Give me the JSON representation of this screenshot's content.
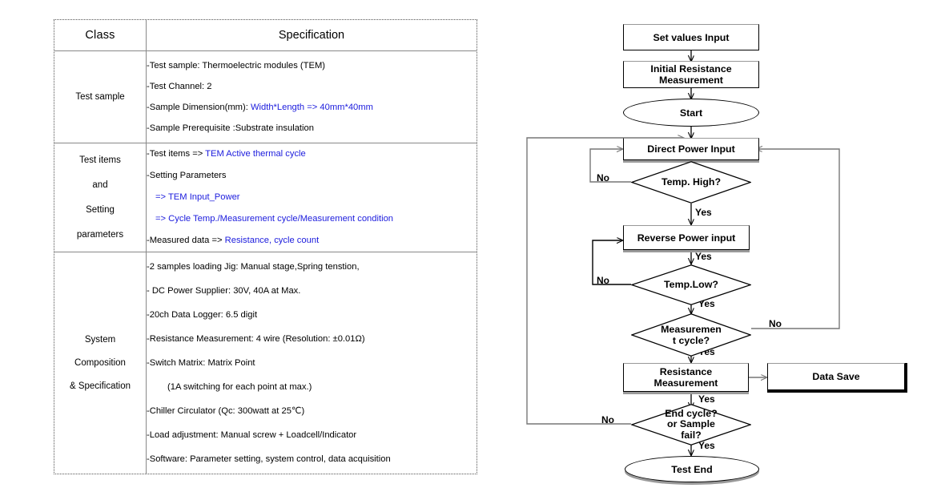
{
  "table": {
    "headers": {
      "class": "Class",
      "specification": "Specification"
    },
    "rows": [
      {
        "class_label": "Test sample",
        "class_lines": [
          "Test sample"
        ],
        "lines": [
          {
            "prefix": "-",
            "black": "Test sample: Thermoelectric modules (TEM)",
            "blue": ""
          },
          {
            "prefix": "-",
            "black": "Test Channel:  2",
            "blue": ""
          },
          {
            "prefix": "-",
            "black": "Sample Dimension(mm): ",
            "blue": "Width*Length => 40mm*40mm"
          },
          {
            "prefix": "-",
            "black": "Sample Prerequisite :Substrate insulation",
            "blue": ""
          }
        ]
      },
      {
        "class_label": "Test items and Setting parameters",
        "class_lines": [
          "Test items",
          "and",
          "Setting",
          "parameters"
        ],
        "lines": [
          {
            "prefix": "-",
            "black": "Test items => ",
            "blue": "TEM Active thermal cycle"
          },
          {
            "prefix": "-",
            "black": "Setting Parameters",
            "blue": ""
          },
          {
            "prefix": "",
            "black": "",
            "blue": "=> TEM Input_Power",
            "indent": 1
          },
          {
            "prefix": "",
            "black": "",
            "blue": "=> Cycle Temp./Measurement cycle/Measurement condition",
            "indent": 1
          },
          {
            "prefix": "-",
            "black": "Measured data => ",
            "blue": "Resistance, cycle count"
          }
        ]
      },
      {
        "class_label": "System Composition & Specification",
        "class_lines": [
          "System",
          "Composition",
          "& Specification"
        ],
        "lines": [
          {
            "prefix": "-",
            "black": "2 samples loading Jig: Manual stage,Spring tenstion,",
            "blue": ""
          },
          {
            "prefix": "-",
            "black": " DC Power Supplier: 30V, 40A at Max.",
            "blue": ""
          },
          {
            "prefix": "-",
            "black": "20ch Data Logger: 6.5 digit",
            "blue": ""
          },
          {
            "prefix": "-",
            "black": "Resistance Measurement: 4 wire (Resolution: ±0.01Ω)",
            "blue": ""
          },
          {
            "prefix": "-",
            "black": "Switch Matrix: Matrix Point",
            "blue": ""
          },
          {
            "prefix": "",
            "black": "(1A switching for each point  at max.)",
            "blue": "",
            "indent": 2
          },
          {
            "prefix": "-",
            "black": "Chiller Circulator (Qc: 300watt at 25℃)",
            "blue": ""
          },
          {
            "prefix": "-",
            "black": "Load adjustment: Manual screw + Loadcell/Indicator",
            "blue": ""
          },
          {
            "prefix": "-",
            "black": "Software: Parameter setting, system control, data acquisition",
            "blue": ""
          }
        ]
      }
    ]
  },
  "flowchart": {
    "nodes": {
      "set_values_input": "Set values Input",
      "initial_resistance_measurement": "Initial Resistance\nMeasurement",
      "start": "Start",
      "direct_power_input": "Direct Power Input",
      "temp_high": "Temp. High?",
      "reverse_power_input": "Reverse Power input",
      "temp_low": "Temp.Low?",
      "measurement_cycle": "Measuremen\nt cycle?",
      "resistance_measurement": "Resistance\nMeasurement",
      "data_save": "Data Save",
      "end_cycle": "End cycle?\nor Sample\nfail?",
      "test_end": "Test End"
    },
    "edge_labels": {
      "temp_high_no": "No",
      "temp_high_yes": "Yes",
      "reverse_yes": "Yes",
      "temp_low_no": "No",
      "temp_low_yes": "Yes",
      "meas_cycle_no": "No",
      "meas_cycle_yes": "Yes",
      "resistance_yes": "Yes",
      "end_cycle_no": "No",
      "end_cycle_yes": "Yes"
    }
  },
  "colors": {
    "accent_blue": "#1b1bdd",
    "line": "#000000",
    "table_border": "#888888"
  }
}
